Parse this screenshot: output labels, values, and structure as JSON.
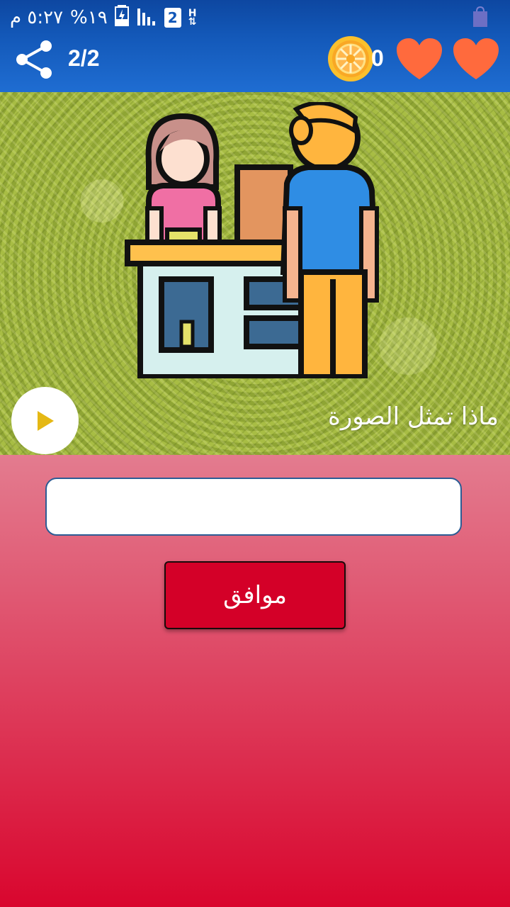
{
  "status_bar": {
    "time": "٥:٢٧ م",
    "battery": "%١٩",
    "network": "2",
    "network_type": "H"
  },
  "app_bar": {
    "level": "2/2",
    "coins": "0",
    "hearts": 2
  },
  "question": {
    "text": "ماذا تمثل الصورة"
  },
  "answer": {
    "value": "",
    "placeholder": ""
  },
  "ok_button": {
    "label": "موافق"
  },
  "colors": {
    "bar_blue": "#1358b8",
    "button_red": "#d40028",
    "heart": "#ff6a3d",
    "coin": "#f9a825"
  }
}
